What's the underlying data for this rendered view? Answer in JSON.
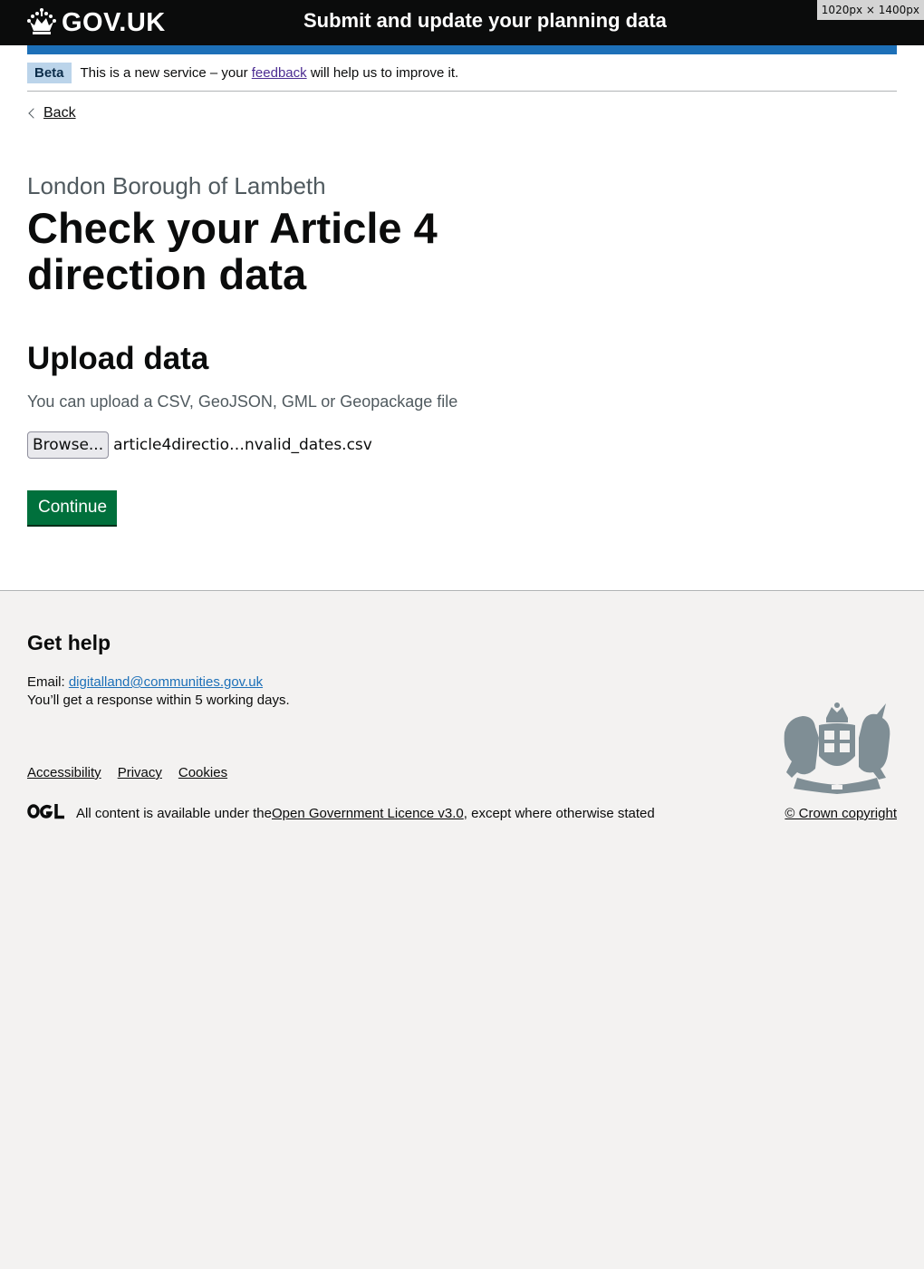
{
  "header": {
    "logo_text": "GOV.UK",
    "service_name": "Submit and update your planning data",
    "viewport_badge": "1020px × 1400px"
  },
  "phase_banner": {
    "tag": "Beta",
    "text_before": "This is a new service – your ",
    "link": "feedback",
    "text_after": " will help us to improve it."
  },
  "back_link": "Back",
  "caption": "London Borough of Lambeth",
  "title": "Check your Article 4 direction data",
  "upload": {
    "heading": "Upload data",
    "hint": "You can upload a CSV, GeoJSON, GML or Geopackage file",
    "browse_label": "Browse...",
    "file_name": "article4directio…nvalid_dates.csv"
  },
  "continue_label": "Continue",
  "footer": {
    "help_heading": "Get help",
    "email_label": "Email: ",
    "email": "digitalland@communities.gov.uk",
    "response": "You’ll get a response within 5 working days.",
    "links": [
      "Accessibility",
      "Privacy",
      "Cookies"
    ],
    "licence_before": "All content is available under the ",
    "licence_link": "Open Government Licence v3.0",
    "licence_after": ", except where otherwise stated",
    "copyright": "© Crown copyright"
  },
  "colors": {
    "header_bg": "#0b0c0c",
    "brand_blue": "#1d70b8",
    "button_green": "#00703c",
    "footer_bg": "#f3f2f1"
  },
  "icons": [
    "crown-icon",
    "chevron-left-icon",
    "ogl-logo-icon",
    "royal-crest-icon"
  ]
}
